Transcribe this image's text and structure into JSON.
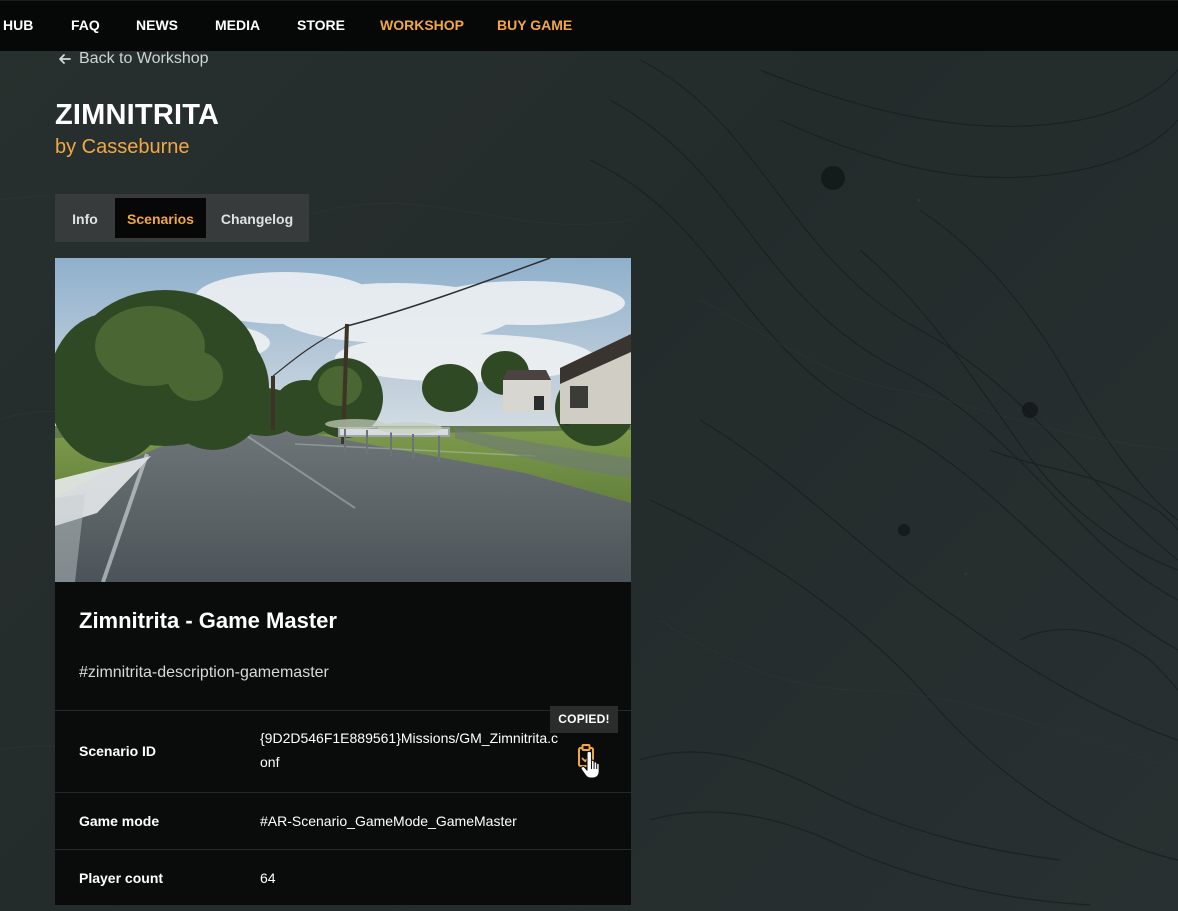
{
  "nav": {
    "items": [
      {
        "label": "HUB",
        "state": "normal"
      },
      {
        "label": "FAQ",
        "state": "normal"
      },
      {
        "label": "NEWS",
        "state": "normal"
      },
      {
        "label": "MEDIA",
        "state": "normal"
      },
      {
        "label": "STORE",
        "state": "normal"
      },
      {
        "label": "WORKSHOP",
        "state": "active"
      },
      {
        "label": "BUY GAME",
        "state": "highlight"
      }
    ]
  },
  "back": {
    "label": "Back to Workshop",
    "icon": "arrow-left-icon"
  },
  "project": {
    "title": "ZIMNITRITA",
    "author_line": "by Casseburne"
  },
  "tabs": [
    {
      "label": "Info",
      "active": false
    },
    {
      "label": "Scenarios",
      "active": true
    },
    {
      "label": "Changelog",
      "active": false
    }
  ],
  "scenario": {
    "name": "Zimnitrita - Game Master",
    "description": "#zimnitrita-description-gamemaster",
    "details": [
      {
        "label": "Scenario ID",
        "value": "{9D2D546F1E889561}Missions/GM_Zimnitrita.conf"
      },
      {
        "label": "Game mode",
        "value": "#AR-Scenario_GameMode_GameMaster"
      },
      {
        "label": "Player count",
        "value": "64"
      }
    ],
    "copy_tooltip": "COPIED!",
    "copy_icon": "clipboard-icon"
  },
  "colors": {
    "accent": "#f2a745",
    "background": "#232a2b",
    "nav_background": "#060707",
    "card_background": "#0a0b0b"
  }
}
